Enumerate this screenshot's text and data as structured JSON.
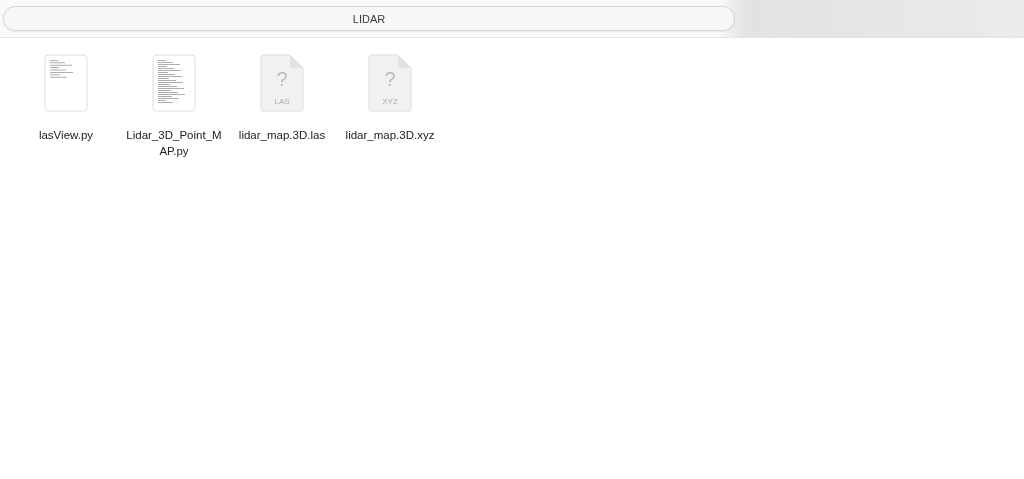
{
  "tabs": [
    {
      "label": "LIDAR",
      "selected": true
    }
  ],
  "files": [
    {
      "name": "lasView.py",
      "kind": "document"
    },
    {
      "name": "Lidar_3D_Point_MAP.py",
      "kind": "document"
    },
    {
      "name": "lidar_map.3D.las",
      "kind": "unknown",
      "badge": "LAS",
      "glyph": "?"
    },
    {
      "name": "lidar_map.3D.xyz",
      "kind": "unknown",
      "badge": "XYZ",
      "glyph": "?"
    }
  ]
}
